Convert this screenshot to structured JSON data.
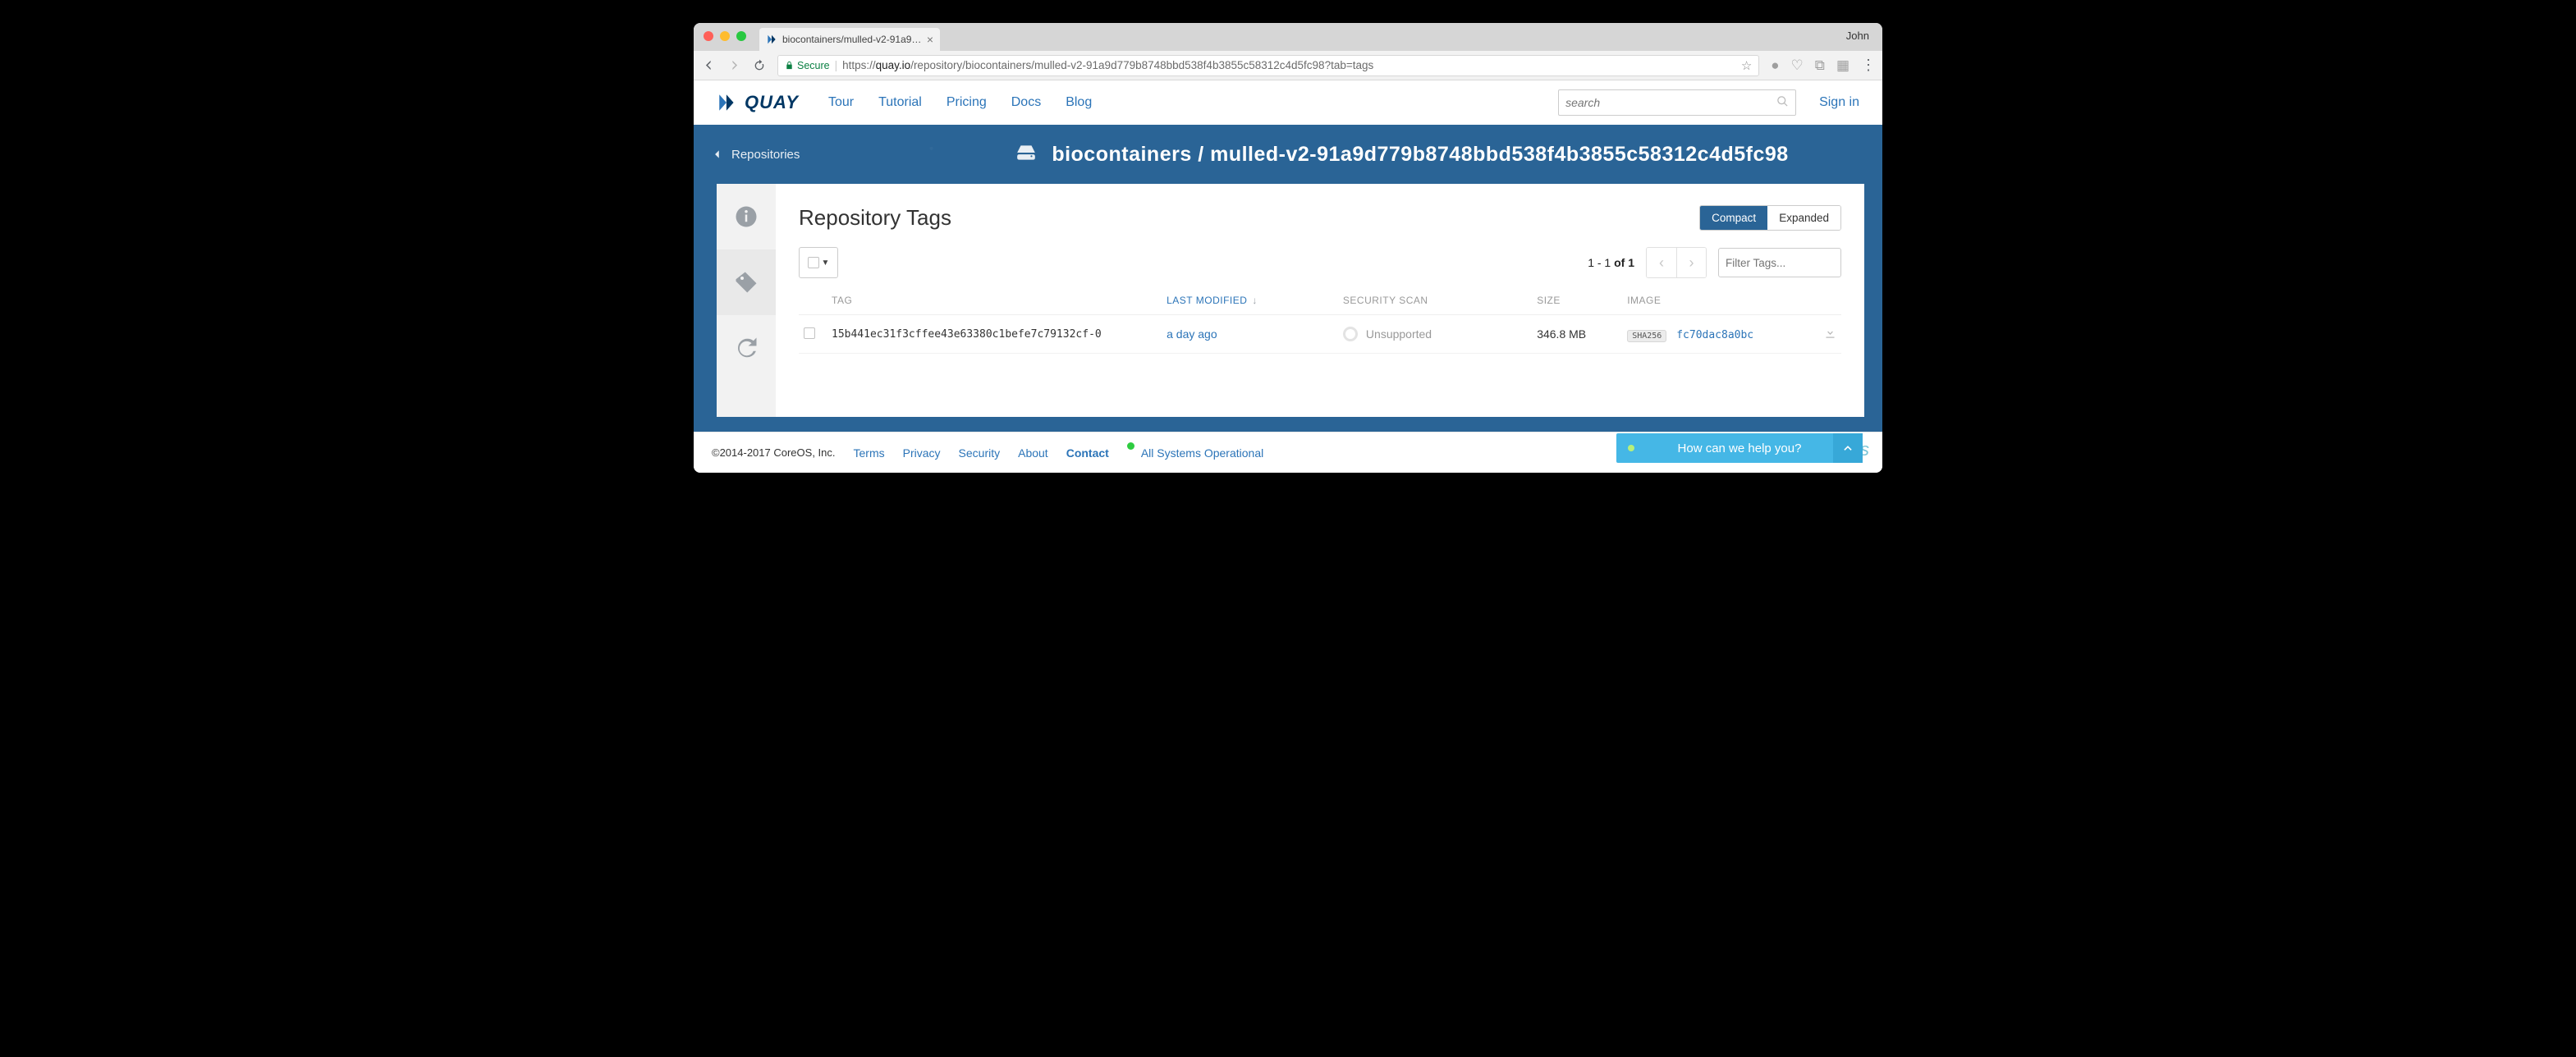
{
  "browser": {
    "profile": "John",
    "tab_title": "biocontainers/mulled-v2-91a9…",
    "secure_label": "Secure",
    "url_prefix": "https://",
    "url_host": "quay.io",
    "url_path": "/repository/biocontainers/mulled-v2-91a9d779b8748bbd538f4b3855c58312c4d5fc98?tab=tags"
  },
  "nav": {
    "brand": "QUAY",
    "links": [
      "Tour",
      "Tutorial",
      "Pricing",
      "Docs",
      "Blog"
    ],
    "search_placeholder": "search",
    "signin": "Sign in"
  },
  "hero": {
    "back": "Repositories",
    "org": "biocontainers",
    "repo": "mulled-v2-91a9d779b8748bbd538f4b3855c58312c4d5fc98"
  },
  "panel": {
    "title": "Repository Tags",
    "view_compact": "Compact",
    "view_expanded": "Expanded",
    "pagination": "1 - 1 of 1",
    "filter_placeholder": "Filter Tags...",
    "columns": {
      "tag": "TAG",
      "modified": "LAST MODIFIED",
      "scan": "SECURITY SCAN",
      "size": "SIZE",
      "image": "IMAGE"
    },
    "rows": [
      {
        "tag": "15b441ec31f3cffee43e63380c1befe7c79132cf-0",
        "modified": "a day ago",
        "scan": "Unsupported",
        "size": "346.8 MB",
        "sha_label": "SHA256",
        "image": "fc70dac8a0bc"
      }
    ]
  },
  "footer": {
    "copyright": "©2014-2017 CoreOS, Inc.",
    "links": [
      "Terms",
      "Privacy",
      "Security",
      "About",
      "Contact"
    ],
    "status": "All Systems Operational",
    "help": "How can we help you?"
  }
}
